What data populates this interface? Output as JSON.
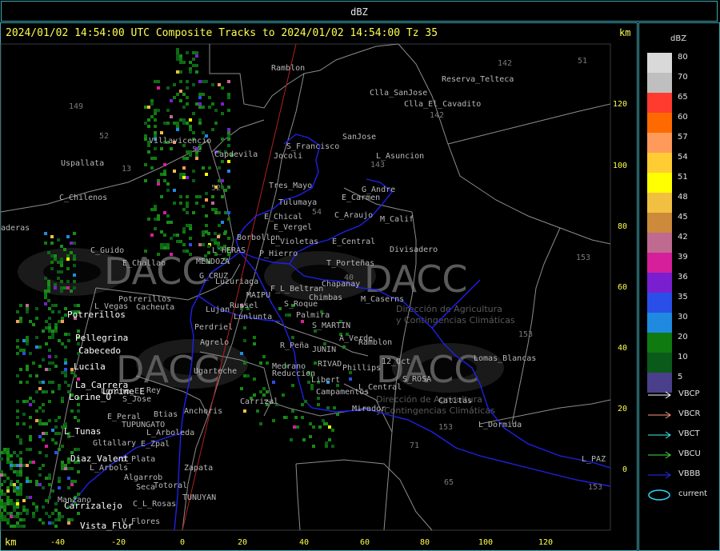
{
  "window": {
    "title": "dBZ"
  },
  "header": {
    "headline": "2024/01/02 14:54:00 UTC Composite Tracks to 2024/01/02 14:54:00 Tz 35",
    "unit_right": "km",
    "unit_bottom": "km"
  },
  "axes": {
    "x_ticks": [
      "-40",
      "-20",
      "0",
      "20",
      "40",
      "60",
      "80",
      "100",
      "120"
    ],
    "y_ticks": [
      "120",
      "100",
      "80",
      "60",
      "40",
      "20",
      "0"
    ]
  },
  "legend": {
    "title": "dBZ",
    "items": [
      {
        "label": "80",
        "color": "#d9d9d9"
      },
      {
        "label": "70",
        "color": "#bfbfbf"
      },
      {
        "label": "65",
        "color": "#ff3b2f"
      },
      {
        "label": "60",
        "color": "#ff6a00"
      },
      {
        "label": "57",
        "color": "#ff9a5a"
      },
      {
        "label": "54",
        "color": "#ffcc33"
      },
      {
        "label": "51",
        "color": "#ffff00"
      },
      {
        "label": "48",
        "color": "#f2c040"
      },
      {
        "label": "45",
        "color": "#cc8a3a"
      },
      {
        "label": "42",
        "color": "#c06a90"
      },
      {
        "label": "39",
        "color": "#d61f9a"
      },
      {
        "label": "36",
        "color": "#7a1fd0"
      },
      {
        "label": "35",
        "color": "#2a4fe8"
      },
      {
        "label": "30",
        "color": "#1f8ae0"
      },
      {
        "label": "20",
        "color": "#0f7a0f"
      },
      {
        "label": "10",
        "color": "#0a5a1a"
      },
      {
        "label": "5",
        "color": "#4a3f8a"
      }
    ]
  },
  "tracks": [
    {
      "label": "VBCP",
      "color": "#ffffff"
    },
    {
      "label": "VBCR",
      "color": "#ff9a7a"
    },
    {
      "label": "VBCT",
      "color": "#3ff0f0"
    },
    {
      "label": "VBCU",
      "color": "#40e040"
    },
    {
      "label": "VBBB",
      "color": "#2a2aff"
    },
    {
      "label": "current",
      "color": "#2ad8ff"
    }
  ],
  "places_gray": [
    "Ramblon",
    "Reserva_Telteca",
    "Clla_SanJose",
    "Clla_El_Cavadito",
    "SanJose",
    "S_Francisco",
    "Uspallata",
    "L_Asuncion",
    "Villavicencio",
    "Capdevila",
    "Jocoli",
    "Tres_Mayo",
    "C_Chilenos",
    "E_Carmen",
    "G_Andre",
    "Tulumaya",
    "E_Chical",
    "C_Araujo",
    "M_Calif",
    "E_Vergel",
    "Borbollon",
    "L_Violetas",
    "E_Central",
    "C_Guido",
    "Divisadero",
    "P_Hierro",
    "E_Challao",
    "L_HERAS",
    "MENDOZA",
    "T_Porteñas",
    "G_CRUZ",
    "Luzuriaga",
    "F_L_Beltran",
    "Chapanay",
    "L_Vegas",
    "Potrerillos",
    "MAIPU",
    "Chimbas",
    "M_Caserns",
    "Cacheuta",
    "Lujan",
    "Russel",
    "S_Roque",
    "Palmira",
    "Lunlunta",
    "S_MARTIN",
    "Perdriel",
    "A_Verde",
    "Agrelo",
    "R_Peña",
    "JUNIN",
    "Ramblon",
    "Medrano",
    "RIVAD",
    "12_Oct",
    "Lomas_Blancas",
    "Ugarteche",
    "Reduccion",
    "Phillips",
    "S_ROSA",
    "Lorine_E",
    "Rey",
    "Libert",
    "L_Central",
    "Campamentos",
    "S_Jose",
    "Carrizal",
    "Catitas",
    "Btias",
    "Anchoris",
    "E_Peral",
    "Mirador",
    "TUPUNGATO",
    "L_Dormida",
    "L_Arboleda",
    "Gltallary",
    "E_Zpal",
    "L_PAZ",
    "d_Plata",
    "L_Arbols",
    "Zapata",
    "Algarrob",
    "Seca",
    "Totoral",
    "Manzano",
    "TUNUYAN",
    "C_L_Rosas",
    "V_Flores",
    "aderas"
  ],
  "places_white": [
    "Potrerillos",
    "Pellegrina",
    "Cabecedo",
    "Lucila",
    "La_Carrera",
    "Lorine_E",
    "Lorine_O",
    "L_Tunas",
    "Diaz_Valent",
    "Carrizalejo",
    "Vista_Flor"
  ],
  "grid_labels": [
    "142",
    "51",
    "149",
    "142",
    "52",
    "13",
    "52",
    "54",
    "143",
    "153",
    "40",
    "153",
    "71",
    "153",
    "65",
    "153",
    "52"
  ],
  "watermark": {
    "brand": "DACC",
    "subtitle_line1": "Dirección de Agricultura",
    "subtitle_line2": "y Contingencias Climáticas"
  }
}
